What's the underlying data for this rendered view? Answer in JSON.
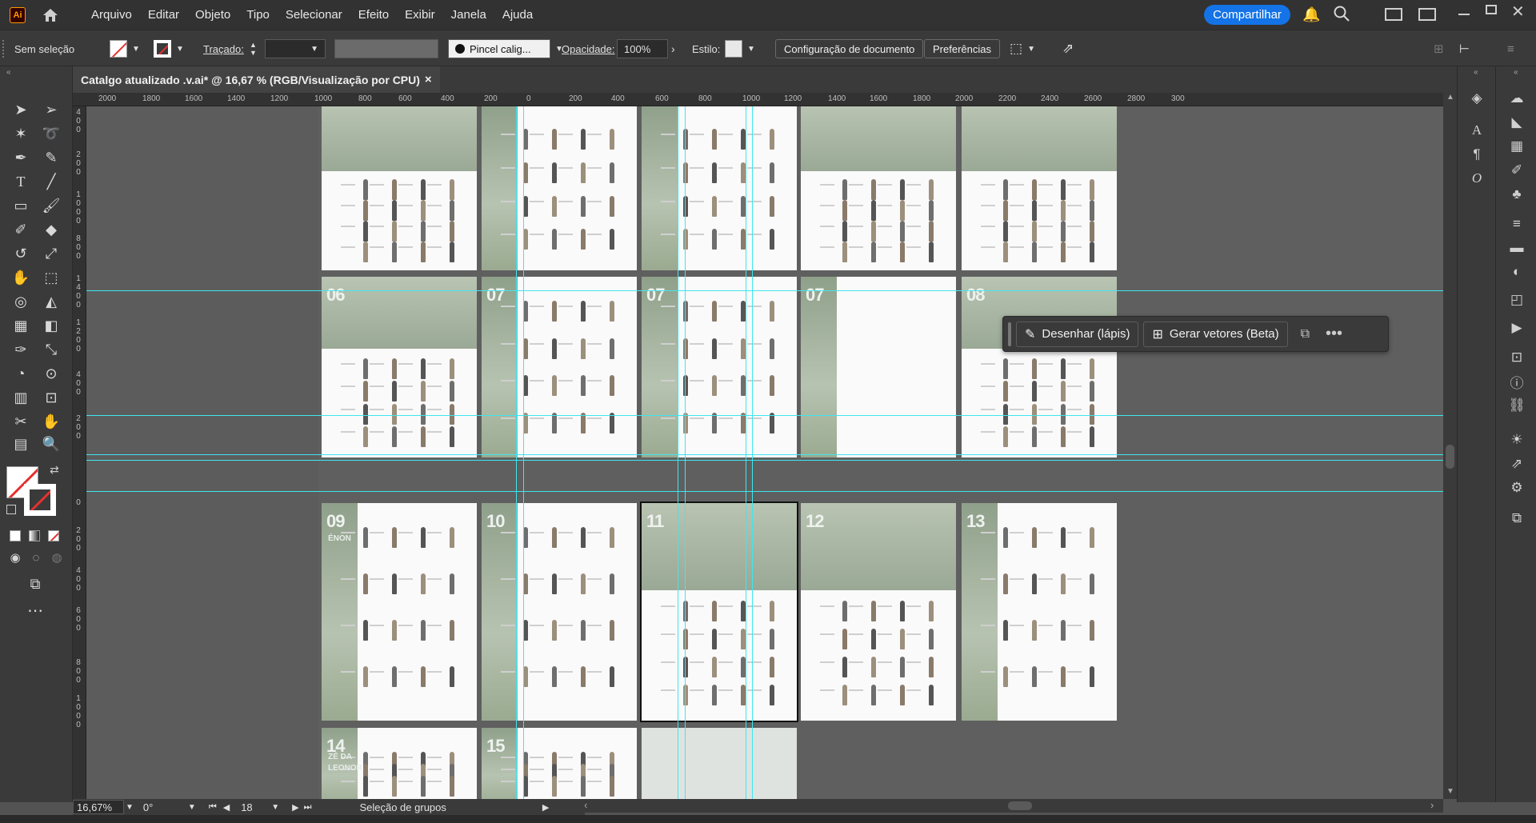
{
  "app": {
    "logo": "Ai",
    "brand_color": "#ff9a00",
    "accent": "#1473e6",
    "guide_color": "#3fe6ef"
  },
  "menu": {
    "items": [
      "Arquivo",
      "Editar",
      "Objeto",
      "Tipo",
      "Selecionar",
      "Efeito",
      "Exibir",
      "Janela",
      "Ajuda"
    ],
    "share_label": "Compartilhar"
  },
  "control": {
    "selection": "Sem seleção",
    "stroke_label": "Traçado:",
    "brush": "Pincel calig...",
    "opacity_label": "Opacidade:",
    "opacity_value": "100%",
    "style_label": "Estilo:",
    "doc_setup": "Configuração de documento",
    "prefs": "Preferências"
  },
  "document": {
    "tab_title": "Catalgo atualizado .v.ai* @ 16,67 % (RGB/Visualização por CPU)",
    "close": "×"
  },
  "ruler": {
    "h_ticks": [
      "2000",
      "1800",
      "1600",
      "1400",
      "1200",
      "1000",
      "800",
      "600",
      "400",
      "200",
      "0",
      "200",
      "400",
      "600",
      "800",
      "1000",
      "1200",
      "1400",
      "1600",
      "1800",
      "2000",
      "2200",
      "2400",
      "2600",
      "2800",
      "300"
    ],
    "v_ticks": [
      "4\n0\n0",
      "2\n0\n0",
      "1\n0\n0\n0",
      "8\n0\n0",
      "1\n4\n0\n0",
      "1\n2\n0\n0",
      "4\n0\n0",
      "2\n0\n0",
      "0",
      "2\n0\n0",
      "4\n0\n0",
      "6\n0\n0",
      "8\n0\n0",
      "1\n0\n0\n0"
    ]
  },
  "pages": {
    "numbers": [
      "06",
      "07",
      "07",
      "07",
      "08",
      "09",
      "10",
      "11",
      "12",
      "13",
      "14",
      "15"
    ],
    "labels": {
      "p09_caption": "ÉNON",
      "p14_caption": "ZÉ DA LEONOR"
    }
  },
  "context_bar": {
    "draw": "Desenhar (lápis)",
    "vectors": "Gerar vetores (Beta)"
  },
  "status": {
    "zoom": "16,67%",
    "rotation": "0°",
    "artboard": "18",
    "tool_status": "Seleção de grupos"
  }
}
